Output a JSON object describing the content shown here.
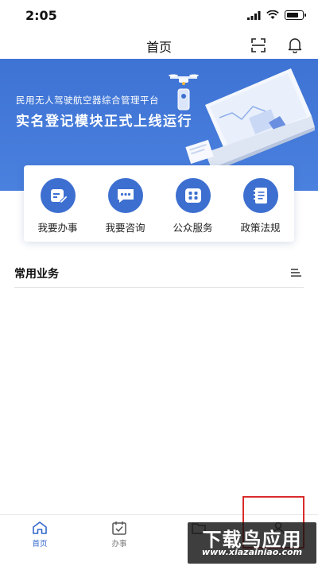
{
  "status_bar": {
    "time": "2:05",
    "battery_level": 0.8
  },
  "nav": {
    "title": "首页"
  },
  "banner": {
    "subtitle": "民用无人驾驶航空器综合管理平台",
    "headline": "实名登记模块正式上线运行"
  },
  "quick_actions": [
    {
      "label": "我要办事",
      "icon": "edit-doc-icon"
    },
    {
      "label": "我要咨询",
      "icon": "chat-icon"
    },
    {
      "label": "公众服务",
      "icon": "grid-icon"
    },
    {
      "label": "政策法规",
      "icon": "book-icon"
    }
  ],
  "section": {
    "title": "常用业务"
  },
  "tabs": [
    {
      "label": "首页",
      "icon": "home-icon",
      "active": true
    },
    {
      "label": "办事",
      "icon": "calendar-check-icon",
      "active": false
    },
    {
      "label": "",
      "icon": "folder-icon",
      "active": false
    },
    {
      "label": "",
      "icon": "user-icon",
      "active": false
    }
  ],
  "watermark": {
    "main": "下载鸟应用",
    "sub": "www.xiazainiao.com"
  },
  "colors": {
    "primary": "#3d6fd0",
    "banner": "#4279d8",
    "highlight": "#d92b2b"
  }
}
